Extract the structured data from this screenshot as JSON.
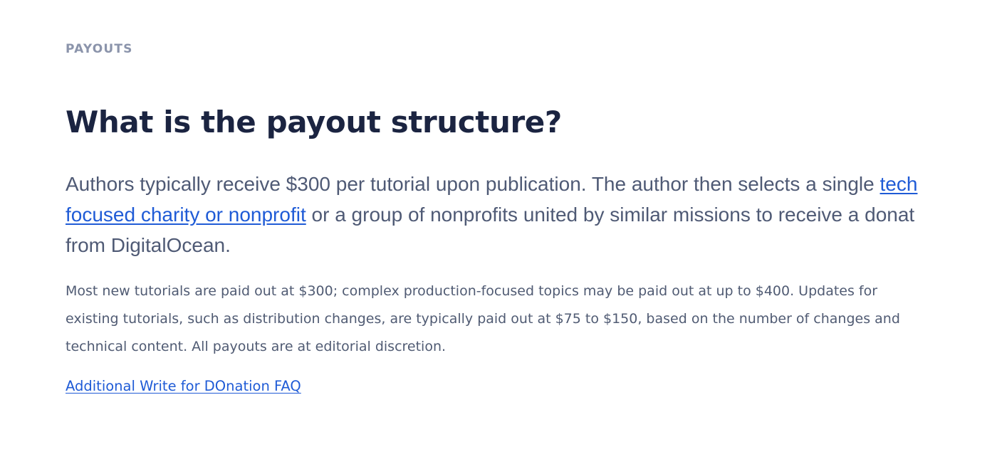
{
  "section": {
    "eyebrow": "PAYOUTS",
    "heading": "What is the payout structure?",
    "lead": {
      "line1_text": "Authors typically receive $300 per tutorial upon publication. The author then selects a single ",
      "line1_link": "tech",
      "line2_link": "focused charity or nonprofit",
      "line2_text": " or a group of nonprofits united by similar missions to receive a donat",
      "line3_text": "from DigitalOcean."
    },
    "detail": {
      "line1": "Most new tutorials are paid out at $300; complex production-focused topics may be paid out at up to $400. Updates for",
      "line2": "existing tutorials, such as distribution changes, are typically paid out at $75 to $150, based on the number of changes and",
      "line3": "technical content. All payouts are at editorial discretion."
    },
    "faq_link": "Additional Write for DOnation FAQ"
  },
  "colors": {
    "eyebrow": "#8b94ab",
    "heading": "#1b2441",
    "body_text": "#4f5a75",
    "link": "#1f5bd6",
    "background": "#ffffff"
  }
}
